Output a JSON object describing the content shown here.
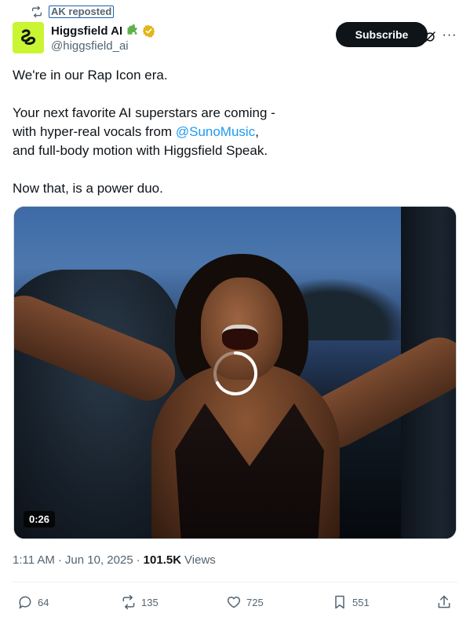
{
  "repost": {
    "icon": "repost-icon",
    "label": "AK reposted"
  },
  "author": {
    "avatar_icon": "higgsfield-logo-icon",
    "display_name": "Higgsfield AI",
    "affiliate_icon": "puzzle-piece-icon",
    "verified_icon": "gold-verified-badge-icon",
    "handle": "@higgsfield_ai"
  },
  "header_actions": {
    "subscribe_label": "Subscribe",
    "grok_icon": "grok-icon",
    "more_label": "···"
  },
  "tweet": {
    "line1": "We're in our Rap Icon era.",
    "line2": "Your next favorite AI superstars are coming -",
    "line3_prefix": "with hyper-real vocals from ",
    "line3_mention": "@SunoMusic",
    "line3_suffix": ",",
    "line4": "and full-body motion with Higgsfield Speak.",
    "line5": "Now that, is a power duo."
  },
  "media": {
    "duration": "0:26",
    "loading_icon": "loading-spinner-icon"
  },
  "meta": {
    "time": "1:11 AM",
    "separator": "·",
    "date": "Jun 10, 2025",
    "views_count": "101.5K",
    "views_label": "Views"
  },
  "actions": {
    "replies": "64",
    "reposts": "135",
    "likes": "725",
    "bookmarks": "551"
  },
  "colors": {
    "accent_link": "#1d9bf0",
    "text_primary": "#0f1419",
    "text_secondary": "#536471",
    "avatar_bg": "#c9f532",
    "verified_gold": "#e2b719"
  }
}
